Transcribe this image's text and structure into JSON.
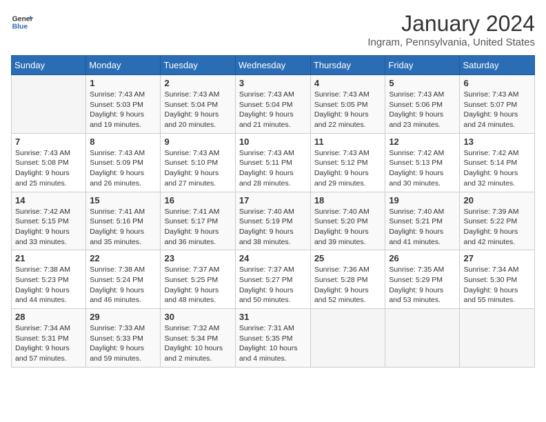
{
  "header": {
    "logo_line1": "General",
    "logo_line2": "Blue",
    "month": "January 2024",
    "location": "Ingram, Pennsylvania, United States"
  },
  "days_of_week": [
    "Sunday",
    "Monday",
    "Tuesday",
    "Wednesday",
    "Thursday",
    "Friday",
    "Saturday"
  ],
  "weeks": [
    [
      {
        "day": "",
        "info": ""
      },
      {
        "day": "1",
        "info": "Sunrise: 7:43 AM\nSunset: 5:03 PM\nDaylight: 9 hours\nand 19 minutes."
      },
      {
        "day": "2",
        "info": "Sunrise: 7:43 AM\nSunset: 5:04 PM\nDaylight: 9 hours\nand 20 minutes."
      },
      {
        "day": "3",
        "info": "Sunrise: 7:43 AM\nSunset: 5:04 PM\nDaylight: 9 hours\nand 21 minutes."
      },
      {
        "day": "4",
        "info": "Sunrise: 7:43 AM\nSunset: 5:05 PM\nDaylight: 9 hours\nand 22 minutes."
      },
      {
        "day": "5",
        "info": "Sunrise: 7:43 AM\nSunset: 5:06 PM\nDaylight: 9 hours\nand 23 minutes."
      },
      {
        "day": "6",
        "info": "Sunrise: 7:43 AM\nSunset: 5:07 PM\nDaylight: 9 hours\nand 24 minutes."
      }
    ],
    [
      {
        "day": "7",
        "info": "Sunrise: 7:43 AM\nSunset: 5:08 PM\nDaylight: 9 hours\nand 25 minutes."
      },
      {
        "day": "8",
        "info": "Sunrise: 7:43 AM\nSunset: 5:09 PM\nDaylight: 9 hours\nand 26 minutes."
      },
      {
        "day": "9",
        "info": "Sunrise: 7:43 AM\nSunset: 5:10 PM\nDaylight: 9 hours\nand 27 minutes."
      },
      {
        "day": "10",
        "info": "Sunrise: 7:43 AM\nSunset: 5:11 PM\nDaylight: 9 hours\nand 28 minutes."
      },
      {
        "day": "11",
        "info": "Sunrise: 7:43 AM\nSunset: 5:12 PM\nDaylight: 9 hours\nand 29 minutes."
      },
      {
        "day": "12",
        "info": "Sunrise: 7:42 AM\nSunset: 5:13 PM\nDaylight: 9 hours\nand 30 minutes."
      },
      {
        "day": "13",
        "info": "Sunrise: 7:42 AM\nSunset: 5:14 PM\nDaylight: 9 hours\nand 32 minutes."
      }
    ],
    [
      {
        "day": "14",
        "info": "Sunrise: 7:42 AM\nSunset: 5:15 PM\nDaylight: 9 hours\nand 33 minutes."
      },
      {
        "day": "15",
        "info": "Sunrise: 7:41 AM\nSunset: 5:16 PM\nDaylight: 9 hours\nand 35 minutes."
      },
      {
        "day": "16",
        "info": "Sunrise: 7:41 AM\nSunset: 5:17 PM\nDaylight: 9 hours\nand 36 minutes."
      },
      {
        "day": "17",
        "info": "Sunrise: 7:40 AM\nSunset: 5:19 PM\nDaylight: 9 hours\nand 38 minutes."
      },
      {
        "day": "18",
        "info": "Sunrise: 7:40 AM\nSunset: 5:20 PM\nDaylight: 9 hours\nand 39 minutes."
      },
      {
        "day": "19",
        "info": "Sunrise: 7:40 AM\nSunset: 5:21 PM\nDaylight: 9 hours\nand 41 minutes."
      },
      {
        "day": "20",
        "info": "Sunrise: 7:39 AM\nSunset: 5:22 PM\nDaylight: 9 hours\nand 42 minutes."
      }
    ],
    [
      {
        "day": "21",
        "info": "Sunrise: 7:38 AM\nSunset: 5:23 PM\nDaylight: 9 hours\nand 44 minutes."
      },
      {
        "day": "22",
        "info": "Sunrise: 7:38 AM\nSunset: 5:24 PM\nDaylight: 9 hours\nand 46 minutes."
      },
      {
        "day": "23",
        "info": "Sunrise: 7:37 AM\nSunset: 5:25 PM\nDaylight: 9 hours\nand 48 minutes."
      },
      {
        "day": "24",
        "info": "Sunrise: 7:37 AM\nSunset: 5:27 PM\nDaylight: 9 hours\nand 50 minutes."
      },
      {
        "day": "25",
        "info": "Sunrise: 7:36 AM\nSunset: 5:28 PM\nDaylight: 9 hours\nand 52 minutes."
      },
      {
        "day": "26",
        "info": "Sunrise: 7:35 AM\nSunset: 5:29 PM\nDaylight: 9 hours\nand 53 minutes."
      },
      {
        "day": "27",
        "info": "Sunrise: 7:34 AM\nSunset: 5:30 PM\nDaylight: 9 hours\nand 55 minutes."
      }
    ],
    [
      {
        "day": "28",
        "info": "Sunrise: 7:34 AM\nSunset: 5:31 PM\nDaylight: 9 hours\nand 57 minutes."
      },
      {
        "day": "29",
        "info": "Sunrise: 7:33 AM\nSunset: 5:33 PM\nDaylight: 9 hours\nand 59 minutes."
      },
      {
        "day": "30",
        "info": "Sunrise: 7:32 AM\nSunset: 5:34 PM\nDaylight: 10 hours\nand 2 minutes."
      },
      {
        "day": "31",
        "info": "Sunrise: 7:31 AM\nSunset: 5:35 PM\nDaylight: 10 hours\nand 4 minutes."
      },
      {
        "day": "",
        "info": ""
      },
      {
        "day": "",
        "info": ""
      },
      {
        "day": "",
        "info": ""
      }
    ]
  ]
}
